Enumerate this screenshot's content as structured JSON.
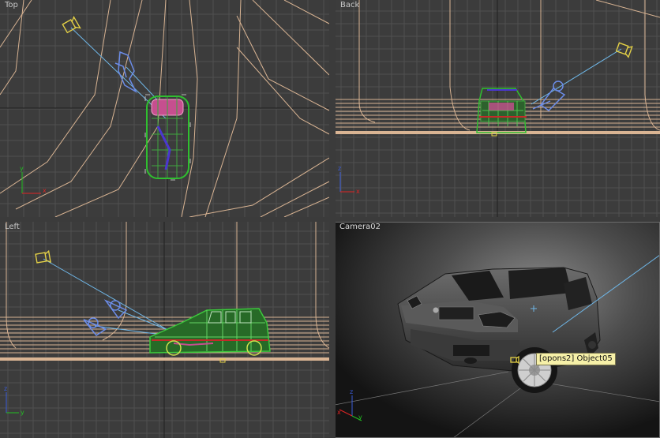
{
  "viewports": {
    "top": {
      "label": "Top"
    },
    "back": {
      "label": "Back"
    },
    "left": {
      "label": "Left"
    },
    "camera": {
      "label": "Camera02",
      "active": true
    }
  },
  "tooltip": {
    "text": "[opons2] Object05"
  },
  "axis_labels": {
    "x": "x",
    "y": "y",
    "z": "z"
  },
  "colors": {
    "viewport_bg": "#3c3c3c",
    "grid_line": "#4f4f4f",
    "grid_major": "#222222",
    "spline": "#d9b493",
    "camera_icon": "#e3d046",
    "camera_target_line": "#6fb7e8",
    "car_wire": "#2fbf2f",
    "light_icon": "#6b8ce8",
    "active_border": "#e0a040",
    "axis_x": "#e02424",
    "axis_y": "#22c022",
    "axis_z": "#3a5bd8"
  },
  "icons": [
    "camera-icon",
    "light-icon",
    "axis-tripod-icon"
  ]
}
